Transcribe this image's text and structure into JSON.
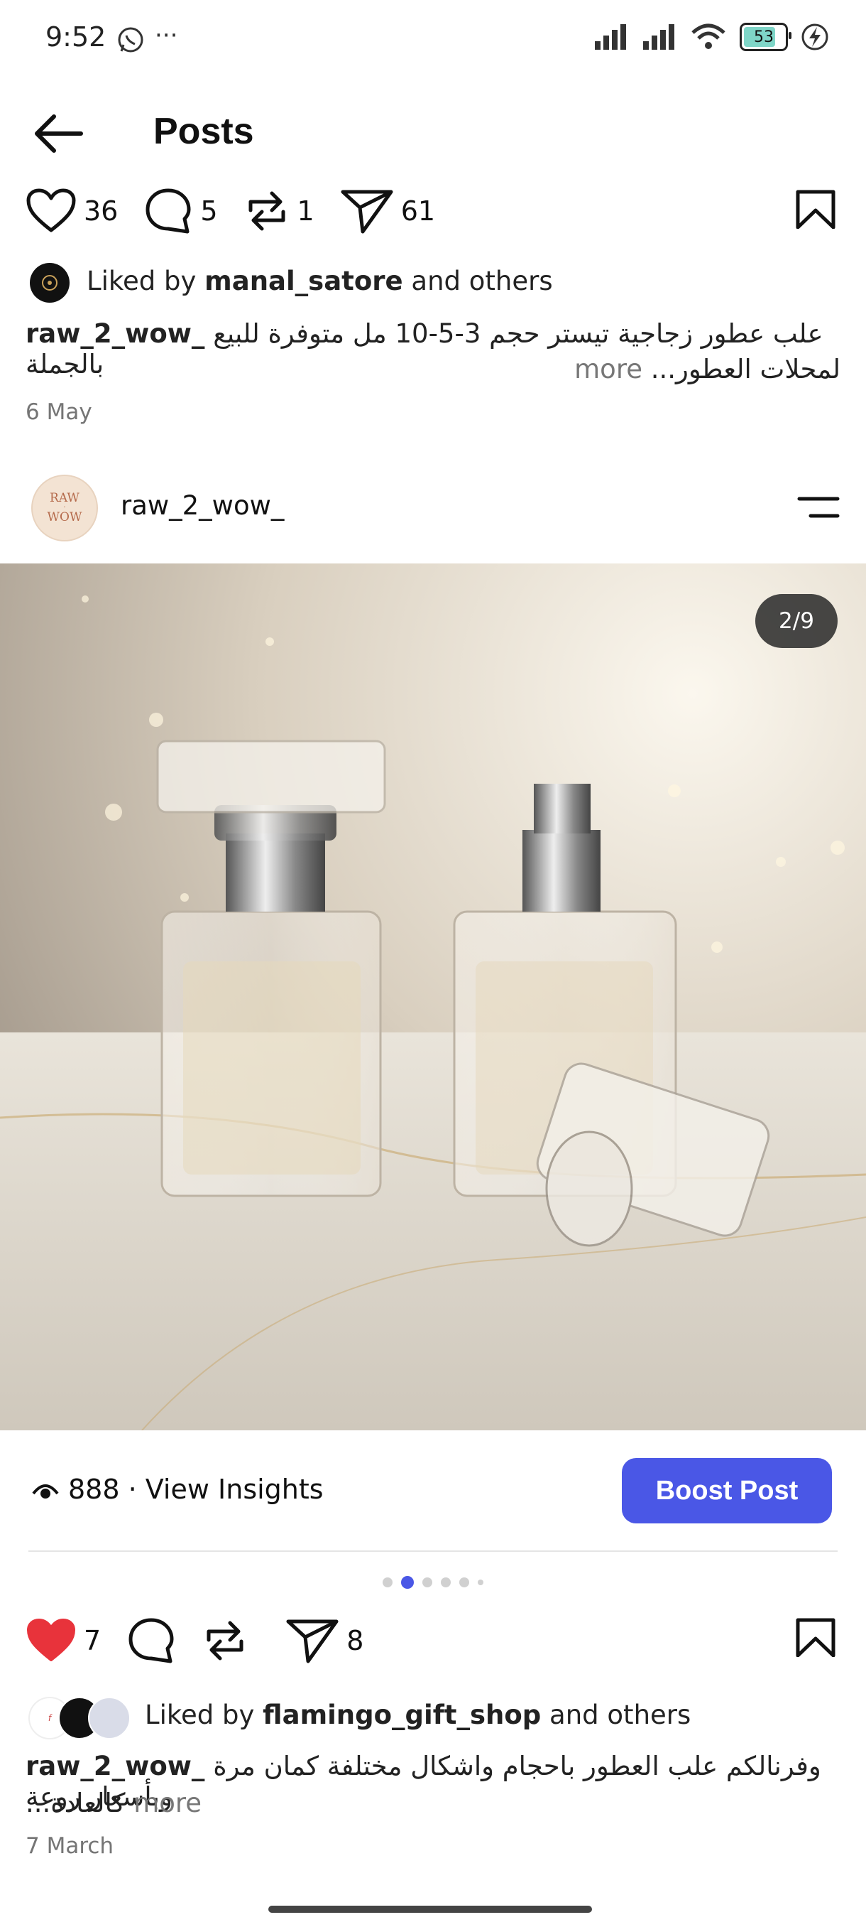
{
  "status_bar": {
    "time": "9:52",
    "battery": "53",
    "more": "···"
  },
  "header": {
    "title": "Posts"
  },
  "post1": {
    "likes": "36",
    "comments": "5",
    "reposts": "1",
    "shares": "61",
    "liked_by_prefix": "Liked by",
    "liked_by_user": "manal_satore",
    "liked_by_suffix": "and others",
    "caption_user": "raw_2_wow_",
    "caption_line1": "علب عطور زجاجية تيستر حجم 3-5-10 مل متوفرة للبيع بالجملة",
    "caption_line2": "لمحلات العطور...",
    "more": "more",
    "date": "6 May"
  },
  "post2": {
    "username": "raw_2_wow_",
    "avatar_text_top": "RAW",
    "avatar_text_bottom": "WOW",
    "image_counter": "2/9",
    "views": "888 · View Insights",
    "boost_label": "Boost Post",
    "likes": "7",
    "shares": "8",
    "liked_by_prefix": "Liked by",
    "liked_by_user": "flamingo_gift_shop",
    "liked_by_suffix": "and others",
    "caption_user": "raw_2_wow_",
    "caption_line1": "وفرنالكم علب العطور باحجام واشكال مختلفة كمان مرة وبأسعار روعة",
    "caption_line2": "كالعادة...",
    "more": "more",
    "date": "7 March",
    "carousel_dots": 6,
    "active_dot": 2
  },
  "colors": {
    "accent": "#4a57e6",
    "heart_liked": "#e8333b",
    "muted": "#757575"
  },
  "icons": [
    "heart-icon",
    "comment-icon",
    "repost-icon",
    "share-icon",
    "bookmark-icon",
    "menu-icon",
    "eye-icon",
    "back-arrow-icon"
  ]
}
